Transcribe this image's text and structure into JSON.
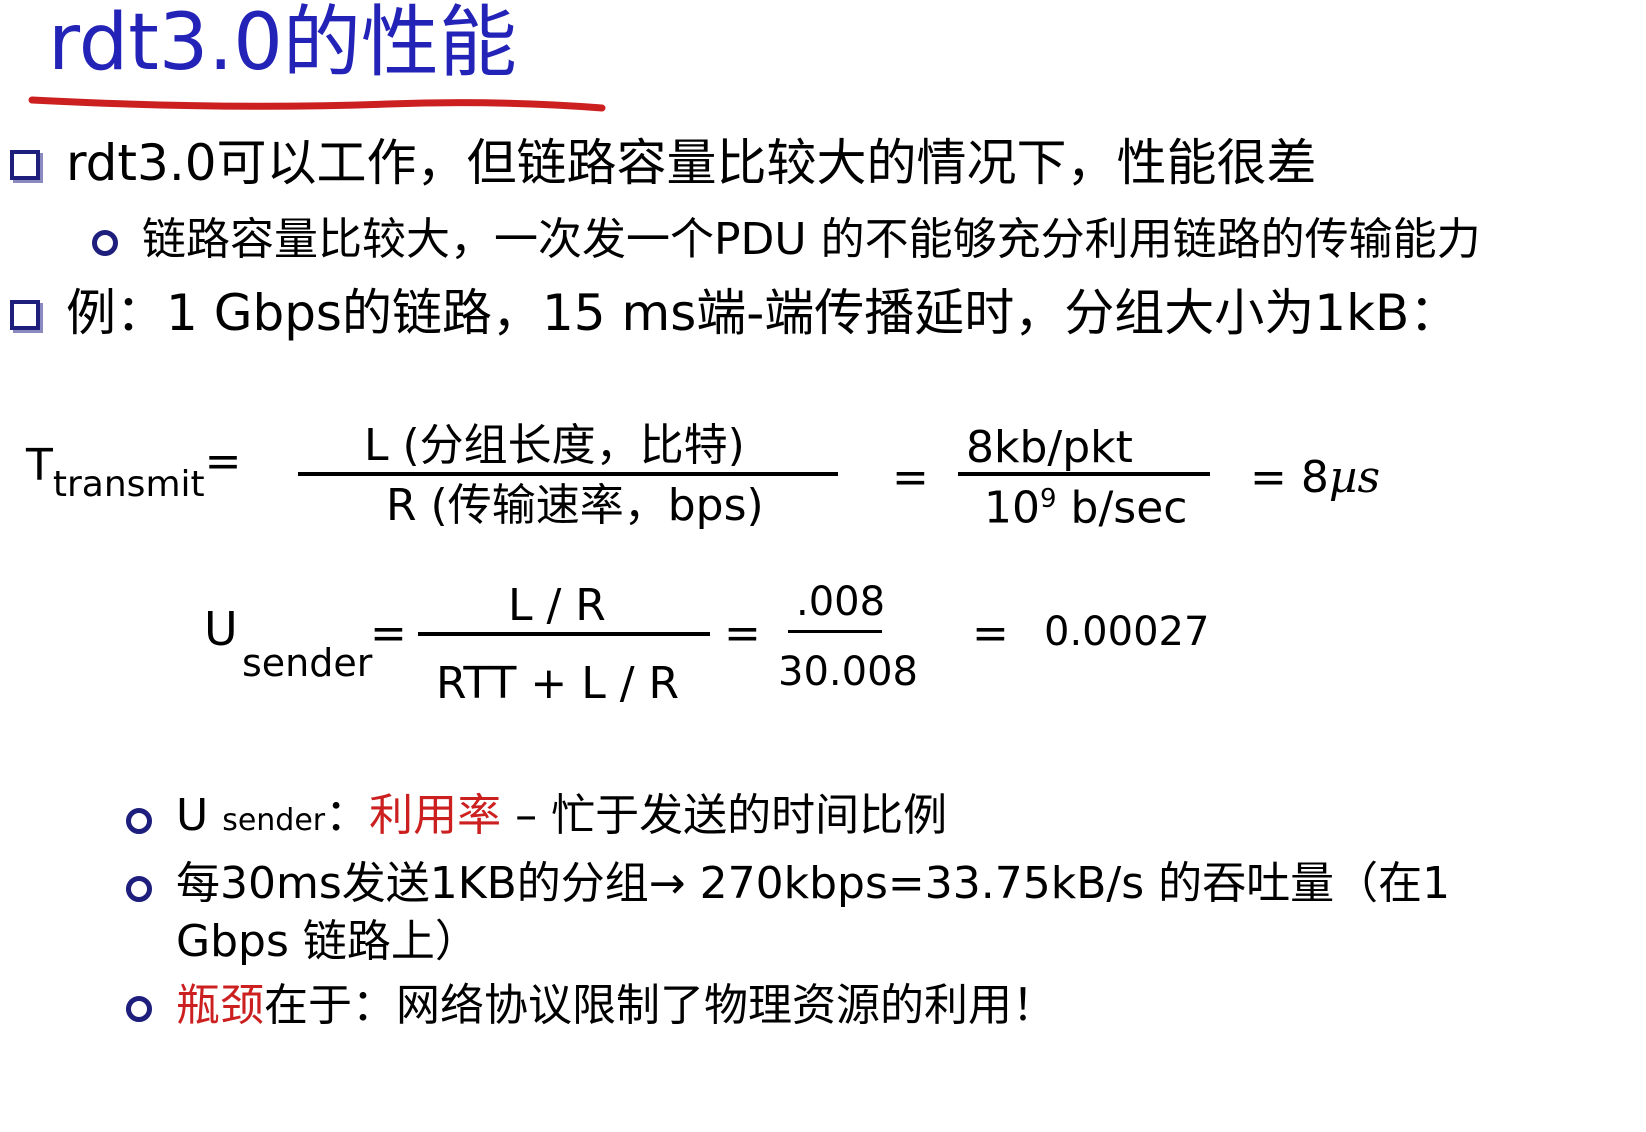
{
  "title": "rdt3.0的性能",
  "bullets": {
    "b1": "rdt3.0可以工作，但链路容量比较大的情况下，性能很差",
    "b1_sub": "链路容量比较大，一次发一个PDU 的不能够充分利用链路的传输能力",
    "b2": "例：1 Gbps的链路，15 ms端-端传播延时，分组大小为1kB："
  },
  "formula1": {
    "lhs_main": "T",
    "lhs_sub": "transmit",
    "eq": "=",
    "num": "L (分组长度，比特)",
    "den": "R (传输速率，bps)",
    "eq2": "=",
    "num2": "8kb/pkt",
    "den2_base": "10",
    "den2_exp": "9",
    "den2_rest": " b/sec",
    "result": "= 8",
    "result_unit": "µs"
  },
  "formula2": {
    "lhs_main": "U",
    "lhs_sub": "sender",
    "eq": "=",
    "num": "L / R",
    "den": "RTT + L / R",
    "eq2": "=",
    "num2": ".008",
    "den2": "30.008",
    "eq3": "=",
    "result": "0.00027"
  },
  "notes": {
    "n1_u": "U ",
    "n1_sub": "sender",
    "n1_colon": "：",
    "n1_red": "利用率",
    "n1_rest": " – 忙于发送的时间比例",
    "n2_line1": "每30ms发送1KB的分组→ 270kbps=33.75kB/s 的吞吐量（在1",
    "n2_line2": "Gbps 链路上）",
    "n3_red": "瓶颈",
    "n3_rest": "在于：网络协议限制了物理资源的利用！"
  },
  "colors": {
    "title": "#2323b8",
    "bullet": "#1e1e7c",
    "underline": "#cc2020",
    "highlight": "#cc2020"
  }
}
